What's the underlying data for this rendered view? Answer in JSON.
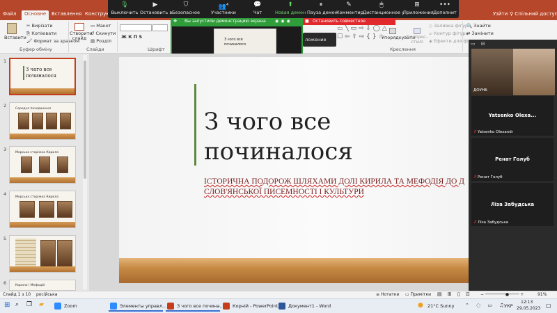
{
  "app": {
    "tabs": [
      "Файл",
      "Основне",
      "Вставлення",
      "Конструктор"
    ],
    "active_tab": "Основне",
    "right_tabs": [
      "Узйти",
      "Спільний доступ"
    ]
  },
  "zoom_toolbar": {
    "items": [
      "Выключить",
      "Остановить в",
      "Безопасное",
      "Участники",
      "Чат",
      "Новая демон",
      "Пауза демон",
      "Комментир",
      "Дистанционное у",
      "Приложения",
      "Дополнит"
    ],
    "participants_count": "4"
  },
  "ribbon": {
    "clipboard": {
      "paste": "Вставити",
      "cut": "Вирізати",
      "copy": "Копіювати",
      "format": "Формат за зразком",
      "group": "Буфер обміну"
    },
    "slides": {
      "new_slide": "Створити слайд",
      "layout": "Макет",
      "reset": "Скинути",
      "section": "Розділ",
      "group": "Слайди"
    },
    "font": {
      "group": "Шрифт"
    },
    "drawing": {
      "arrange": "Упорядкувати",
      "styles": "Експрес-стилі",
      "fill": "Заливка фігури",
      "outline": "Контур фігури",
      "effects": "Ефекти для фігур",
      "group": "Креслення"
    },
    "editing": {
      "find": "Знайти",
      "replace": "Замінити",
      "select": "Виділити"
    }
  },
  "share": {
    "banner": "Вы запустили демонстрацию экрана",
    "stop": "Остановить совместное использование",
    "tooltip": "ложение"
  },
  "thumbnails": [
    {
      "num": "1",
      "title": "З чого все починалося"
    },
    {
      "num": "2",
      "title": "Середнє походження"
    },
    {
      "num": "3",
      "title": "Морська сторіжка Кирила"
    },
    {
      "num": "4",
      "title": "Морська сторіжка Кирила"
    },
    {
      "num": "5",
      "title": ""
    },
    {
      "num": "6",
      "title": "Кирило і Мефодій"
    }
  ],
  "slide": {
    "title": "З чого все починалося",
    "subtitle": "Історична подорож шляхами долі Кирила та Мефодія до д слов'янської писемності і культури"
  },
  "gallery": [
    {
      "name": "",
      "sub": "ДОУНБ"
    },
    {
      "name": "Yatsenko Olexa...",
      "sub": "Yatsenko Olexandr"
    },
    {
      "name": "Ренат Голуб",
      "sub": "Ренат Голуб"
    },
    {
      "name": "Ліза Забудська",
      "sub": "Ліза Забудська"
    }
  ],
  "status": {
    "slide_info": "Слайд 1 з 10",
    "language": "російська",
    "notes": "Нотатки",
    "comments": "Примітки",
    "zoom": "91%"
  },
  "taskbar": {
    "items": [
      "Zoom",
      "Элементы управл...",
      "З чого все почина...",
      "Корній - PowerPoint",
      "Документ1 - Word"
    ],
    "weather": "21°C  Sunny",
    "lang": "УКР",
    "time": "12:13",
    "date": "29.05.2023"
  }
}
